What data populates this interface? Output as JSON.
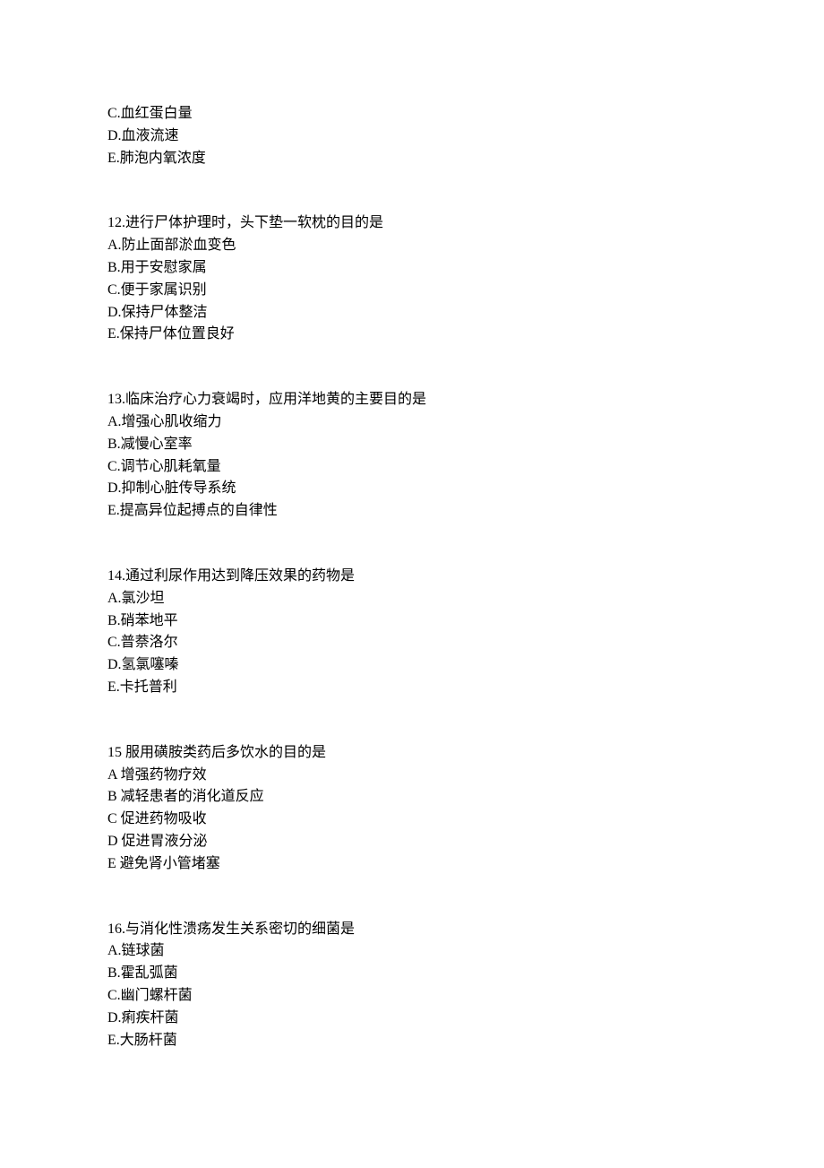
{
  "orphan_options": {
    "c": "C.血红蛋白量",
    "d": "D.血液流速",
    "e": "E.肺泡内氧浓度"
  },
  "q12": {
    "stem": "12.进行尸体护理时，头下垫一软枕的目的是",
    "a": "A.防止面部淤血变色",
    "b": "B.用于安慰家属",
    "c": "C.便于家属识别",
    "d": "D.保持尸体整洁",
    "e": "E.保持尸体位置良好"
  },
  "q13": {
    "stem": "13.临床治疗心力衰竭时，应用洋地黄的主要目的是",
    "a": "A.增强心肌收缩力",
    "b": "B.减慢心室率",
    "c": "C.调节心肌耗氧量",
    "d": "D.抑制心脏传导系统",
    "e": "E.提高异位起搏点的自律性"
  },
  "q14": {
    "stem": "14.通过利尿作用达到降压效果的药物是",
    "a": "A.氯沙坦",
    "b": "B.硝苯地平",
    "c": "C.普萘洛尔",
    "d": "D.氢氯噻嗪",
    "e": "E.卡托普利"
  },
  "q15": {
    "stem": "15 服用磺胺类药后多饮水的目的是",
    "a": "A 增强药物疗效",
    "b": "B 减轻患者的消化道反应",
    "c": "C 促进药物吸收",
    "d": "D 促进胃液分泌",
    "e": "E 避免肾小管堵塞"
  },
  "q16": {
    "stem": "16.与消化性溃疡发生关系密切的细菌是",
    "a": "A.链球菌",
    "b": "B.霍乱弧菌",
    "c": "C.幽门螺杆菌",
    "d": "D.痢疾杆菌",
    "e": "E.大肠杆菌"
  }
}
